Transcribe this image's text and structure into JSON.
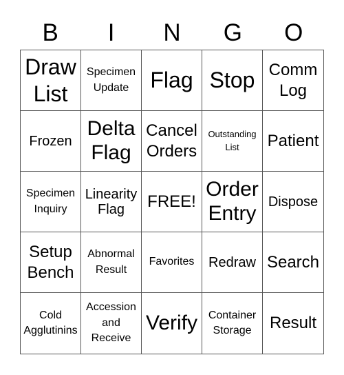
{
  "header": {
    "letters": [
      "B",
      "I",
      "N",
      "G",
      "O"
    ]
  },
  "board": {
    "cells": [
      "Draw List",
      "Specimen Update",
      "Flag",
      "Stop",
      "Comm Log",
      "Frozen",
      "Delta Flag",
      "Cancel Orders",
      "Outstanding List",
      "Patient",
      "Specimen Inquiry",
      "Linearity Flag",
      "FREE!",
      "Order Entry",
      "Dispose",
      "Setup Bench",
      "Abnormal Result",
      "Favorites",
      "Redraw",
      "Search",
      "Cold Agglutinins",
      "Accession and Receive",
      "Verify",
      "Container Storage",
      "Result"
    ]
  }
}
